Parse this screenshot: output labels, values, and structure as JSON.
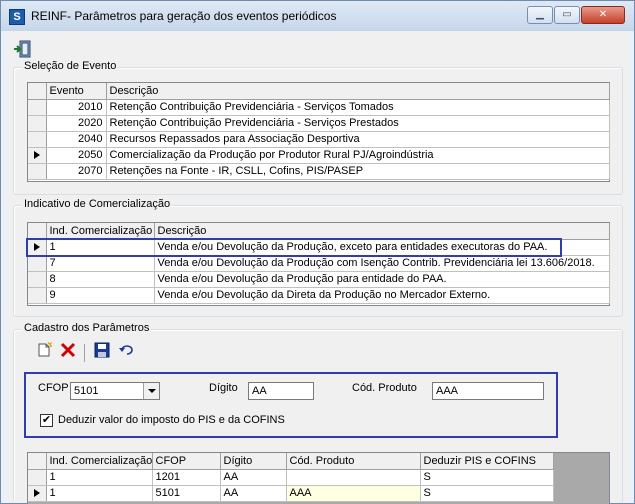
{
  "window": {
    "title": "REINF- Parâmetros para geração dos eventos periódicos",
    "icon": "app-s-icon"
  },
  "toolbar": {
    "exit_icon": "exit-door-icon"
  },
  "selecao_evento": {
    "label": "Seleção de Evento",
    "columns": [
      "Evento",
      "Descrição"
    ],
    "rows": [
      {
        "evento": "2010",
        "descricao": "Retenção Contribuição Previdenciária - Serviços Tomados"
      },
      {
        "evento": "2020",
        "descricao": "Retenção Contribuição Previdenciária - Serviços Prestados"
      },
      {
        "evento": "2040",
        "descricao": "Recursos Repassados para Associação Desportiva"
      },
      {
        "evento": "2050",
        "descricao": "Comercialização da Produção por Produtor Rural PJ/Agroindústria"
      },
      {
        "evento": "2070",
        "descricao": "Retenções na Fonte - IR, CSLL, Cofins, PIS/PASEP"
      }
    ],
    "selected_row": 3
  },
  "indicativo": {
    "label": "Indicativo de Comercialização",
    "columns": [
      "Ind. Comercialização",
      "Descrição"
    ],
    "rows": [
      {
        "ind": "1",
        "descricao": "Venda e/ou Devolução da Produção, exceto para entidades executoras do PAA."
      },
      {
        "ind": "7",
        "descricao": "Venda e/ou Devolução da Produção com Isenção Contrib. Previdenciária lei 13.606/2018."
      },
      {
        "ind": "8",
        "descricao": "Venda e/ou Devolução da Produção para entidade do PAA."
      },
      {
        "ind": "9",
        "descricao": "Venda e/ou Devolução da Direta da Produção no Mercador Externo."
      }
    ],
    "selected_row": 0
  },
  "cadastro": {
    "label": "Cadastro dos Parâmetros",
    "buttons": {
      "new_icon": "new-document-icon",
      "delete_icon": "delete-x-icon",
      "save_icon": "save-disk-icon",
      "undo_icon": "undo-icon"
    },
    "form": {
      "cfop_label": "CFOP",
      "cfop_value": "5101",
      "digito_label": "Dígito",
      "digito_value": "AA",
      "cod_produto_label": "Cód. Produto",
      "cod_produto_value": "AAA",
      "deduzir_label": "Deduzir valor do imposto do PIS e da COFINS",
      "deduzir_checked": "✔"
    },
    "grid": {
      "columns": [
        "Ind. Comercialização",
        "CFOP",
        "Dígito",
        "Cód. Produto",
        "Deduzir PIS e COFINS"
      ],
      "rows": [
        {
          "ind": "1",
          "cfop": "1201",
          "digito": "AA",
          "cod_produto": "",
          "deduzir": "S"
        },
        {
          "ind": "1",
          "cfop": "5101",
          "digito": "AA",
          "cod_produto": "AAA",
          "deduzir": "S"
        }
      ],
      "selected_row": 1
    }
  },
  "colors": {
    "selection_border": "#2f3ea8",
    "editing_cell": "#ffffe1"
  }
}
